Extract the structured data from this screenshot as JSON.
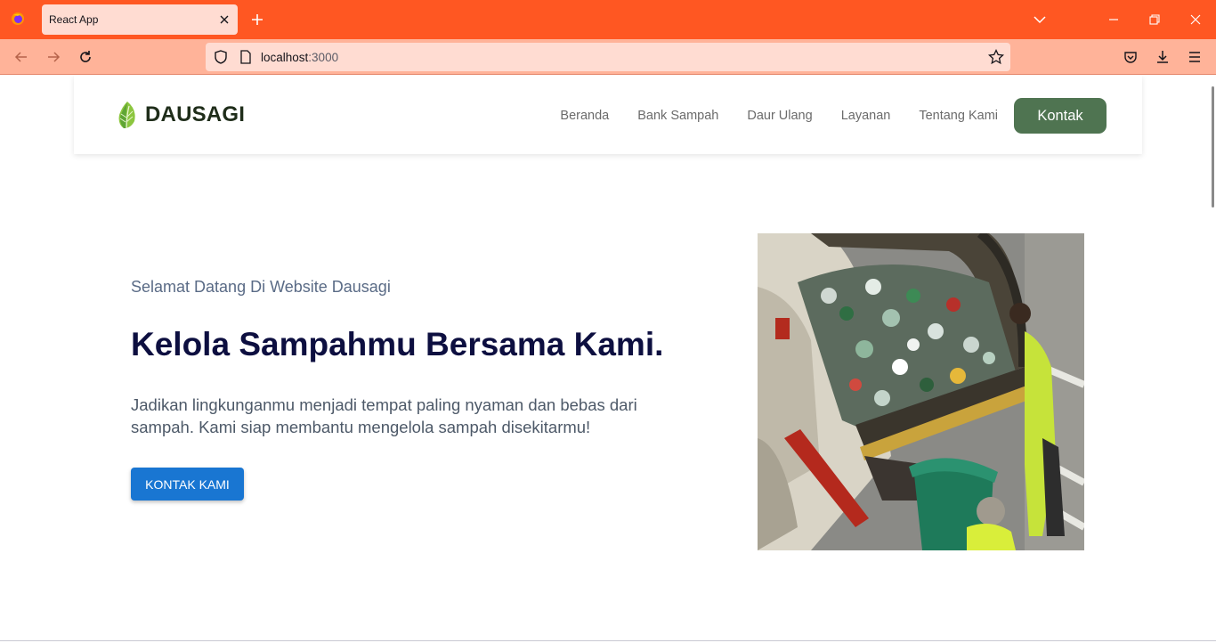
{
  "browser": {
    "tab_title": "React App",
    "url_host": "localhost",
    "url_port": ":3000",
    "accent": "#ff5722"
  },
  "header": {
    "brand": "DAUSAGI",
    "nav": [
      "Beranda",
      "Bank Sampah",
      "Daur Ulang",
      "Layanan",
      "Tentang Kami"
    ],
    "contact_label": "Kontak",
    "contact_color": "#4f7451"
  },
  "hero": {
    "subtitle": "Selamat Datang Di Website Dausagi",
    "title": "Kelola Sampahmu Bersama Kami.",
    "description": "Jadikan lingkunganmu menjadi tempat paling nyaman dan bebas dari sampah. Kami siap membantu mengelola sampah disekitarmu!",
    "cta_label": "KONTAK KAMI",
    "cta_color": "#1976d2"
  }
}
